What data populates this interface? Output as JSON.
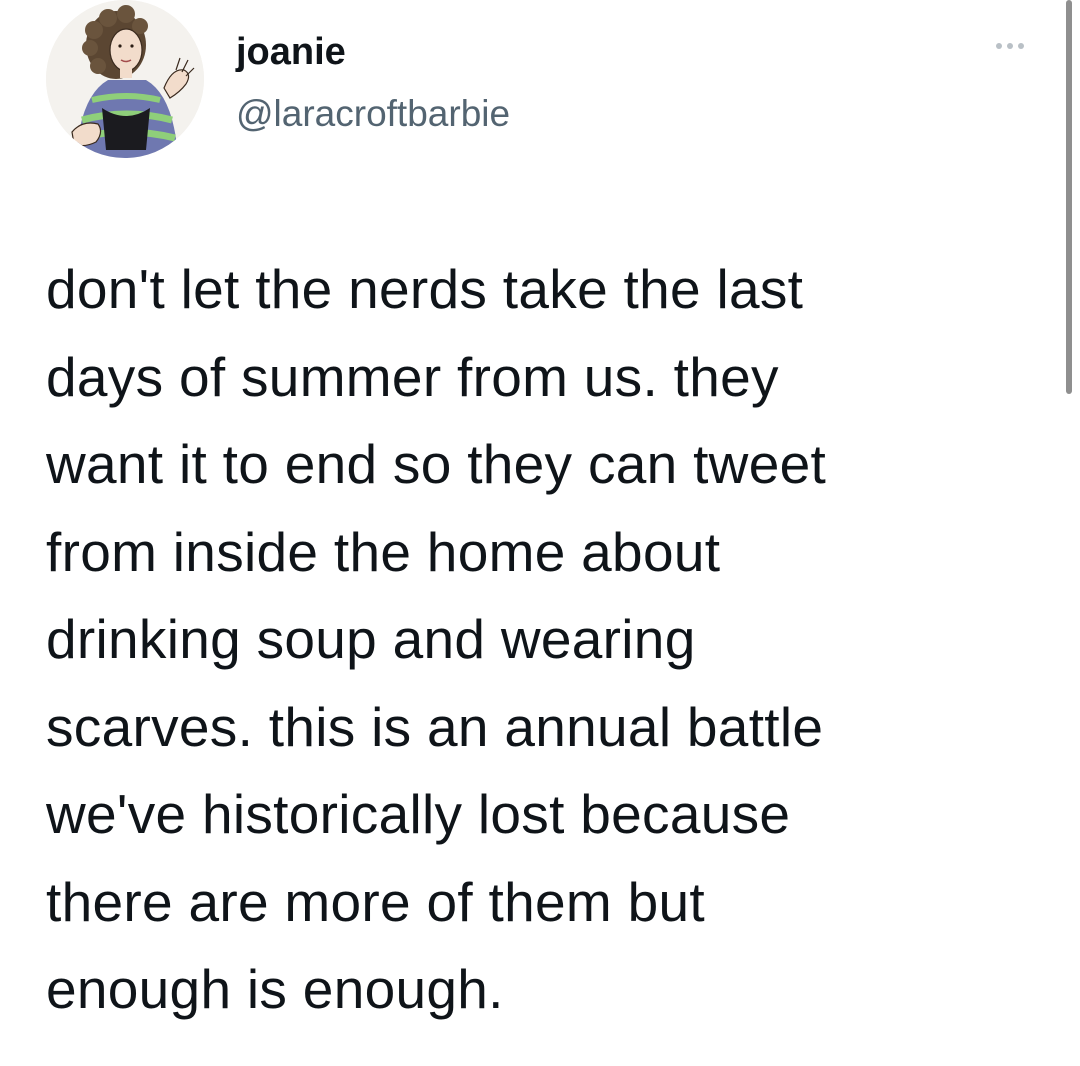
{
  "user": {
    "display_name": "joanie",
    "handle": "@laracroftbarbie",
    "avatar_icon": "illustrated-avatar-icon"
  },
  "menu": {
    "more_icon": "more-horizontal-icon"
  },
  "tweet": {
    "text": "don't let the nerds take the last\ndays of summer from us. they\nwant it to end so they can tweet\nfrom inside the home about\ndrinking soup and wearing\nscarves. this is an annual battle\nwe've historically lost because\nthere are more of them but\nenough is enough."
  },
  "colors": {
    "text": "#0f1419",
    "secondary_text": "#536471",
    "background": "#ffffff"
  }
}
